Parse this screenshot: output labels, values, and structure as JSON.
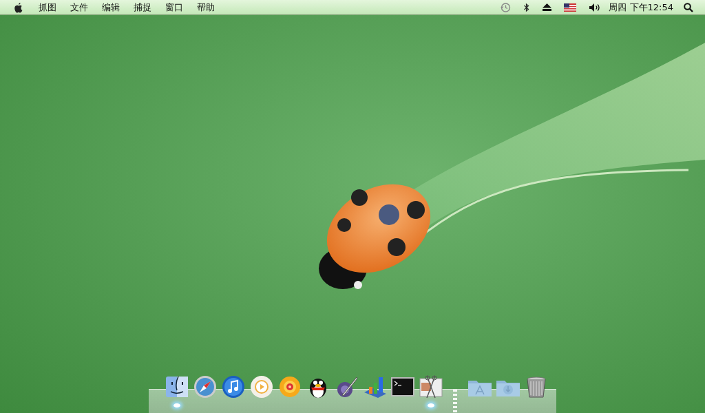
{
  "menu_bar": {
    "app_name": "抓图",
    "menus": [
      "文件",
      "编辑",
      "捕捉",
      "窗口",
      "帮助"
    ],
    "clock": "周四 下午12:54"
  },
  "dock": {
    "items": [
      {
        "kind": "finder",
        "running": true
      },
      {
        "kind": "safari",
        "running": false
      },
      {
        "kind": "itunes",
        "running": false
      },
      {
        "kind": "player",
        "running": false
      },
      {
        "kind": "sun",
        "running": false
      },
      {
        "kind": "penguin",
        "running": false
      },
      {
        "kind": "pen",
        "running": false
      },
      {
        "kind": "chart",
        "running": false
      },
      {
        "kind": "terminal",
        "running": false
      },
      {
        "kind": "scissors",
        "running": true
      }
    ],
    "stacks": [
      {
        "kind": "apps-folder",
        "running": false
      },
      {
        "kind": "downloads-folder",
        "running": false
      },
      {
        "kind": "trash",
        "running": false
      }
    ]
  }
}
